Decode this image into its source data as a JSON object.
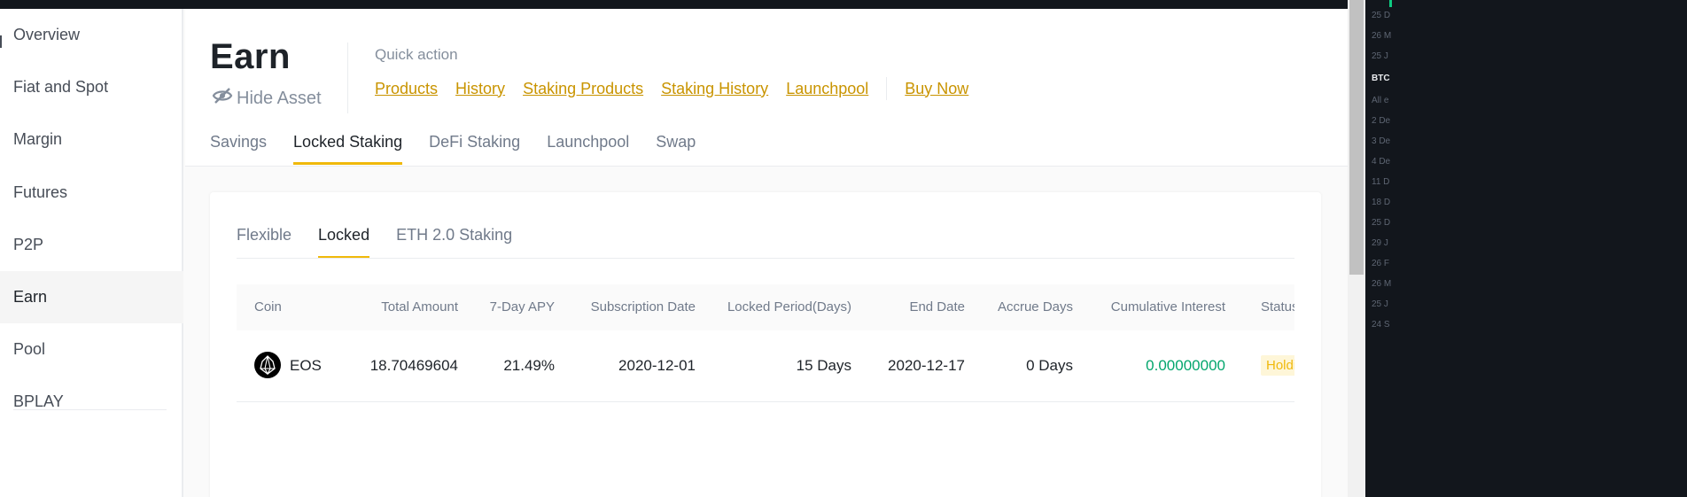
{
  "sidebar": {
    "items": [
      {
        "label": "Overview"
      },
      {
        "label": "Fiat and Spot"
      },
      {
        "label": "Margin"
      },
      {
        "label": "Futures"
      },
      {
        "label": "P2P"
      },
      {
        "label": "Earn"
      },
      {
        "label": "Pool"
      },
      {
        "label": "BPLAY"
      }
    ],
    "active": "Earn"
  },
  "header": {
    "title": "Earn",
    "hide_asset": "Hide Asset",
    "quick_action_label": "Quick action",
    "quick_links": [
      "Products",
      "History",
      "Staking Products",
      "Staking History",
      "Launchpool"
    ],
    "buy_now": "Buy Now"
  },
  "tabs": [
    {
      "label": "Savings"
    },
    {
      "label": "Locked Staking"
    },
    {
      "label": "DeFi Staking"
    },
    {
      "label": "Launchpool"
    },
    {
      "label": "Swap"
    }
  ],
  "active_tab": "Locked Staking",
  "subtabs": [
    {
      "label": "Flexible"
    },
    {
      "label": "Locked"
    },
    {
      "label": "ETH 2.0 Staking"
    }
  ],
  "active_subtab": "Locked",
  "table": {
    "columns": [
      "Coin",
      "Total Amount",
      "7-Day APY",
      "Subscription Date",
      "Locked Period(Days)",
      "End Date",
      "Accrue Days",
      "Cumulative Interest",
      "Status"
    ],
    "rows": [
      {
        "coin": "EOS",
        "total_amount": "18.70469604",
        "apy": "21.49%",
        "subscription_date": "2020-12-01",
        "locked_period": "15 Days",
        "end_date": "2020-12-17",
        "accrue_days": "0 Days",
        "cumulative_interest": "0.00000000",
        "status": "Holding"
      }
    ]
  },
  "right_panel": {
    "lines": [
      "25 D",
      "26 M",
      "25 J",
      "BTC",
      "All e",
      "2 De",
      "3 De",
      "4 De",
      "11 D",
      "18 D",
      "25 D",
      "29 J",
      "26 F",
      "26 M",
      "25 J",
      "24 S"
    ]
  },
  "colors": {
    "accent": "#f0b90b",
    "link": "#c99400",
    "positive": "#03a66d",
    "dark_bar": "#12161c"
  }
}
